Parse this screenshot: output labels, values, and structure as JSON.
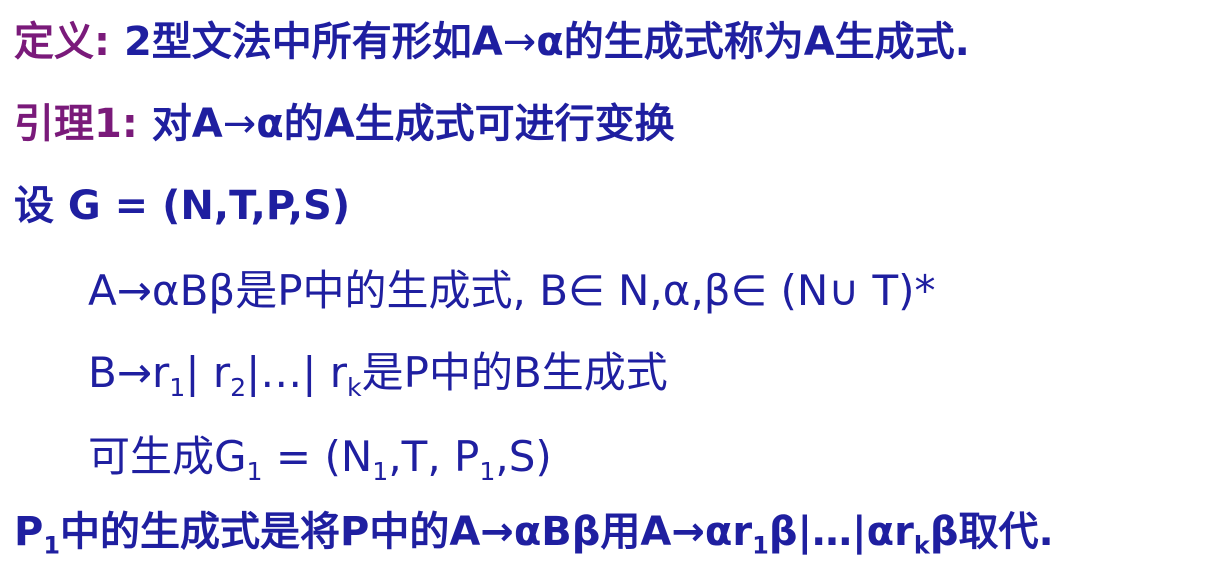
{
  "definition": {
    "label": "定义:",
    "text_a": "2型文法中所有形如A",
    "arrow": "→",
    "text_b": "α的生成式称为A生成式."
  },
  "lemma": {
    "label": "引理1:",
    "text_a": "对A",
    "arrow": "→",
    "text_b": "α的A生成式可进行变换"
  },
  "setup": {
    "text": "设 G = (N,T,P,S)"
  },
  "rule_a": {
    "text": "A→αBβ是P中的生成式, B∈ N,α,β∈ (N∪ T)*"
  },
  "rule_b": {
    "p1": "B→r",
    "s1": "1",
    "p2": "| r",
    "s2": "2",
    "p3": "|…| r",
    "s3": "k",
    "p4": "是P中的B生成式"
  },
  "rule_c": {
    "p1": "可生成G",
    "s1": "1",
    "p2": " = (N",
    "s2": "1",
    "p3": ",T, P",
    "s3": "1",
    "p4": ",S)"
  },
  "conclusion": {
    "p1": "P",
    "s1": "1",
    "p2": "中的生成式是将P中的A→αBβ用A→αr",
    "s2": "1",
    "p3": "β|…|αr",
    "s3": "k",
    "p4": "β取代."
  },
  "colors": {
    "label_purple": "#7a1a7a",
    "body_blue": "#1f1fa0"
  }
}
